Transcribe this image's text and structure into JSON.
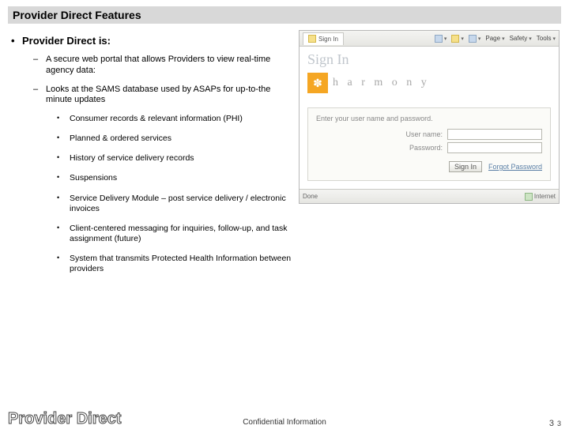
{
  "title": "Provider Direct Features",
  "heading": "Provider Direct is:",
  "sub1": "A secure web portal that allows Providers to view real-time agency data:",
  "sub2": "Looks at the SAMS database used by ASAPs for up-to-the minute updates",
  "items": [
    "Consumer records & relevant information (PHI)",
    "Planned & ordered services",
    "History of service delivery records",
    "Suspensions",
    "Service Delivery Module – post service delivery / electronic invoices",
    "Client-centered messaging for inquiries, follow-up, and task assignment (future)",
    "System that transmits Protected Health Information between providers"
  ],
  "browser": {
    "tab": "Sign In",
    "tools": {
      "page": "Page",
      "safety": "Safety",
      "tools": "Tools"
    },
    "signin_title": "Sign In",
    "harmony": "h a r m o n y",
    "prompt": "Enter your user name and password.",
    "user_label": "User name:",
    "pass_label": "Password:",
    "signin_btn": "Sign In",
    "forgot": "Forgot Password",
    "status_left": "Done",
    "status_right": "Internet"
  },
  "footer": {
    "logo": "Provider Direct",
    "confidential": "Confidential Information",
    "page_a": "3",
    "page_b": "3"
  }
}
